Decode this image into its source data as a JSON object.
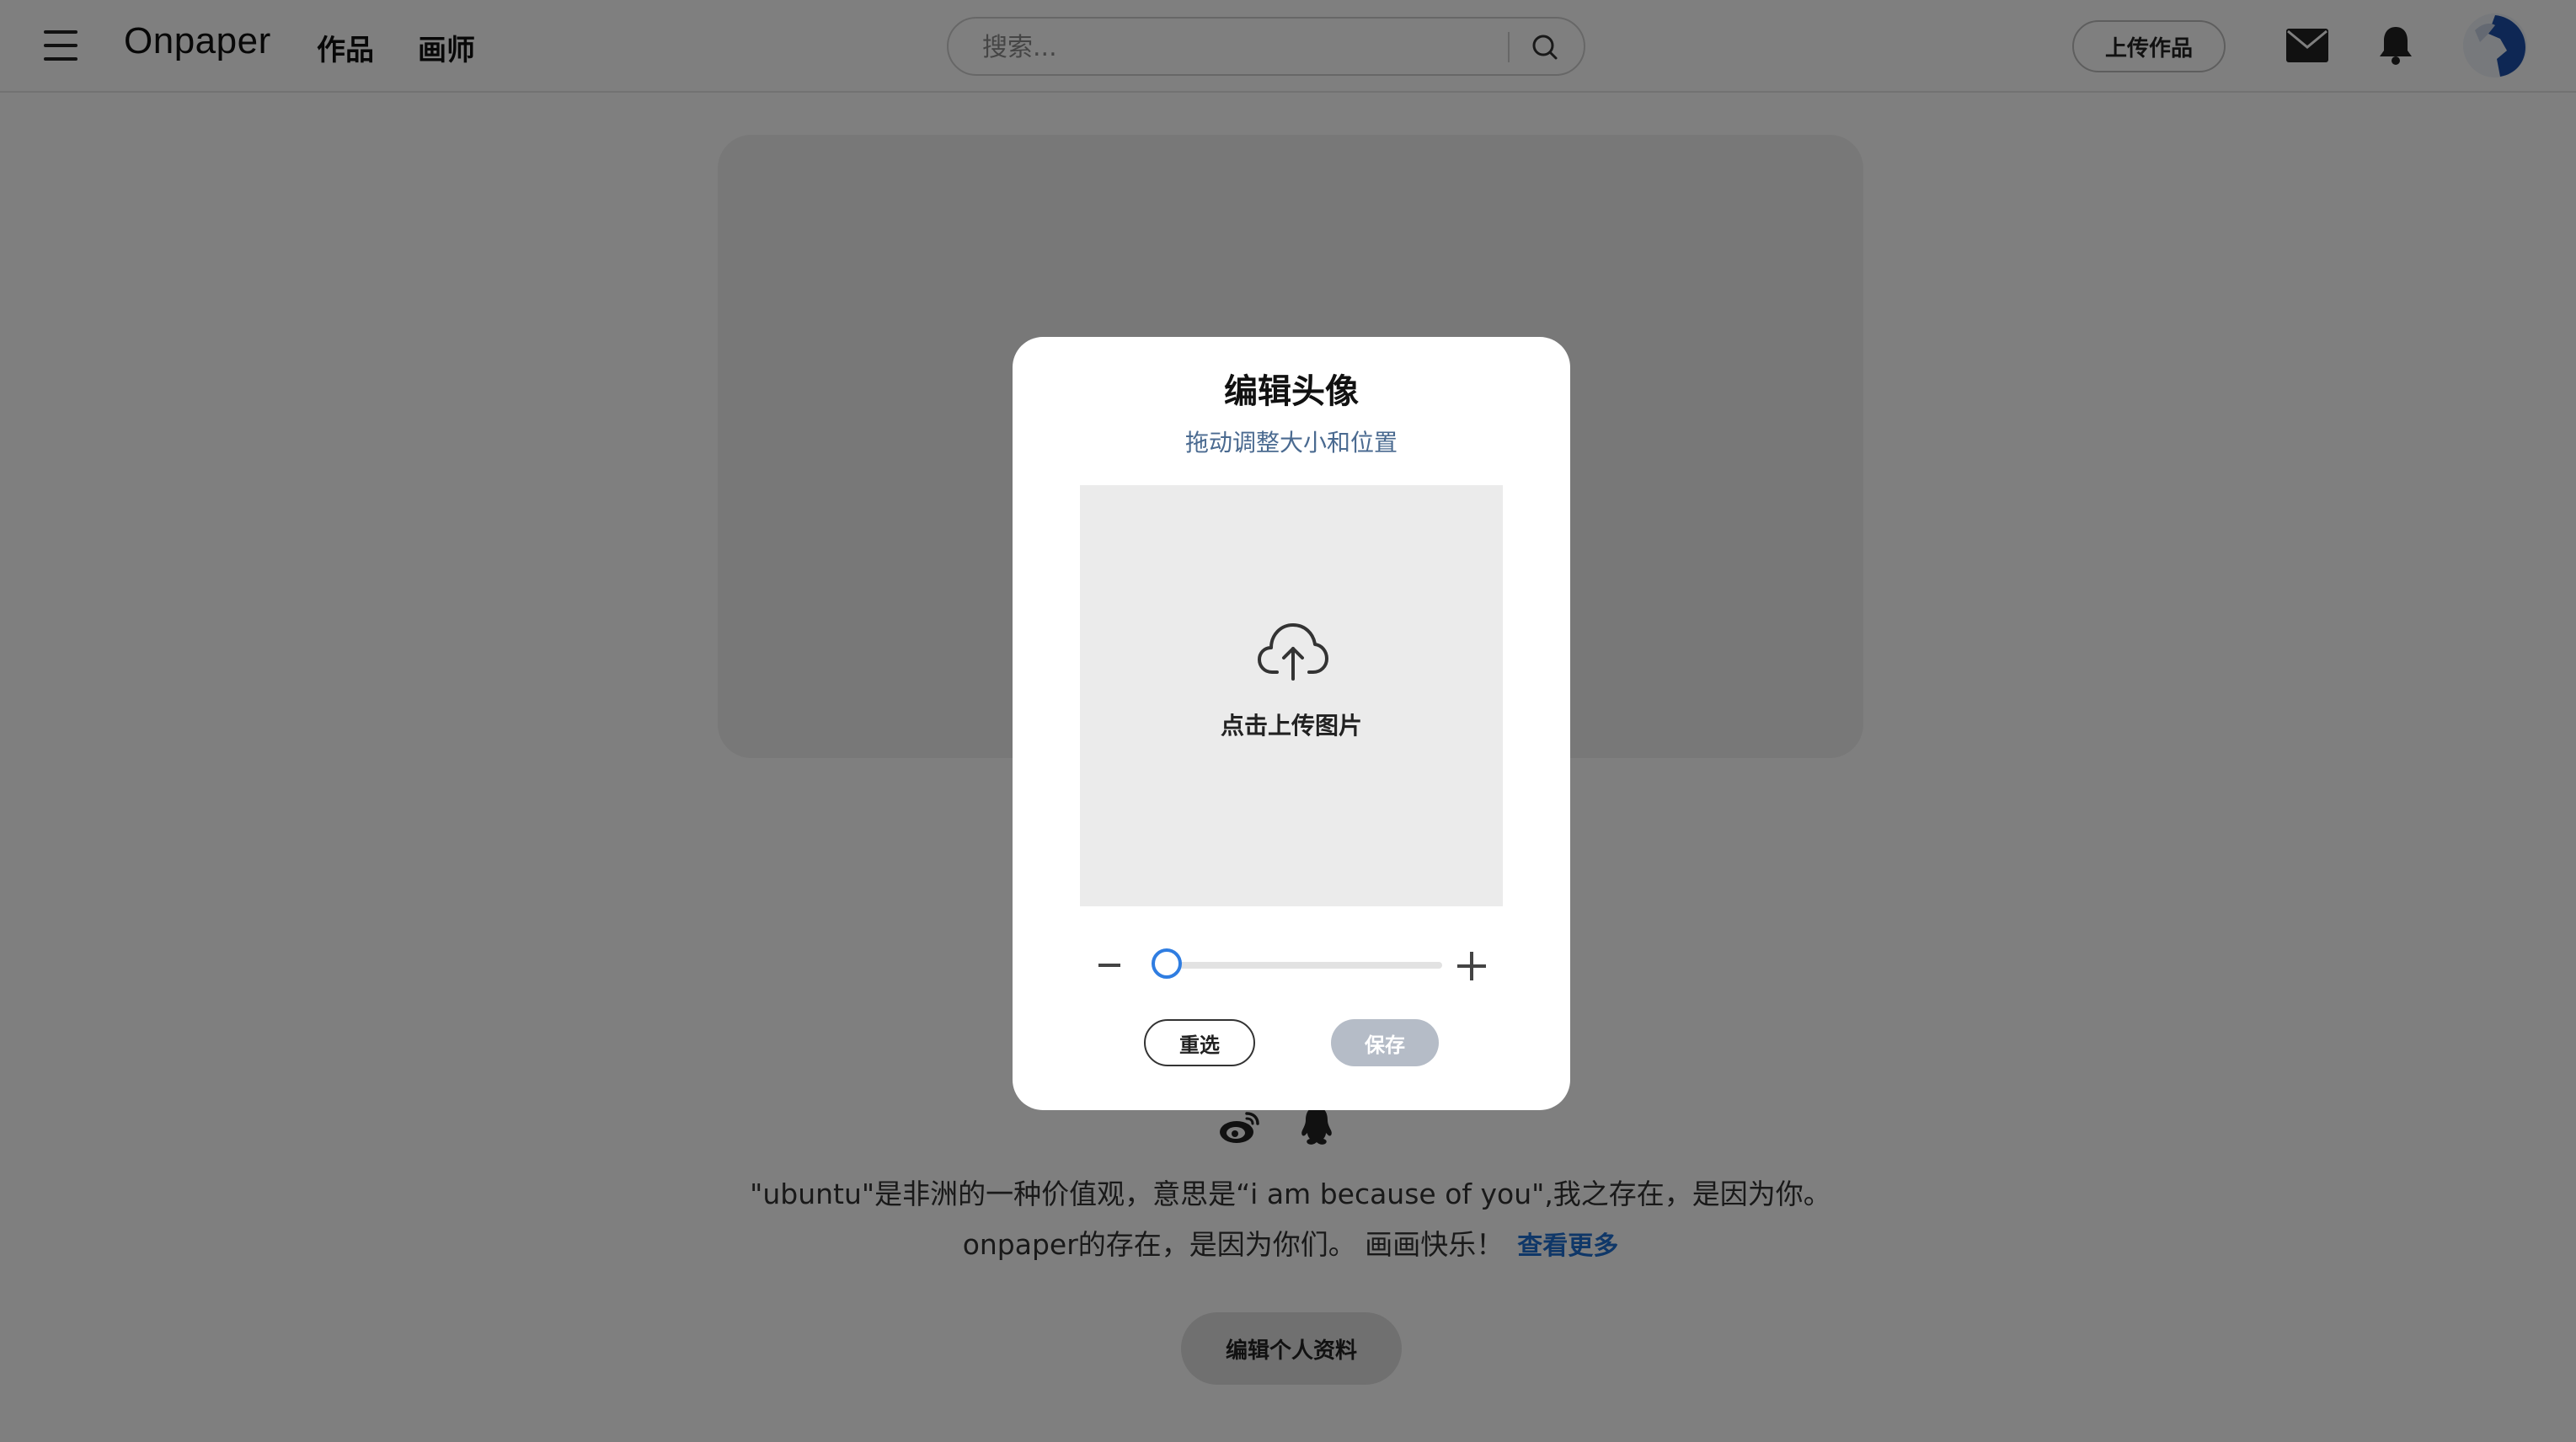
{
  "header": {
    "logo": "Onpaper",
    "nav": [
      "作品",
      "画师"
    ],
    "search_placeholder": "搜索...",
    "upload_label": "上传作品",
    "icons": [
      "menu-icon",
      "search-icon",
      "mail-icon",
      "bell-icon"
    ]
  },
  "profile": {
    "bio_text": "\"ubuntu\"是非洲的一种价值观，意思是“i am because of you\",我之存在，是因为你。onpaper的存在，是因为你们。 画画快乐！",
    "more_label": "查看更多",
    "edit_profile_label": "编辑个人资料",
    "social_icons": [
      "weibo-icon",
      "qq-icon"
    ]
  },
  "modal": {
    "title": "编辑头像",
    "subtitle": "拖动调整大小和位置",
    "upload_hint": "点击上传图片",
    "zoom_value": 0.05,
    "reselect_label": "重选",
    "save_label": "保存",
    "save_disabled": true
  },
  "colors": {
    "overlay": "rgba(0,0,0,0.5)",
    "accent": "#2f7de1",
    "subtitle": "#4a6a90",
    "link": "#1f6fd1",
    "save_disabled_bg": "#b5bcc7"
  }
}
